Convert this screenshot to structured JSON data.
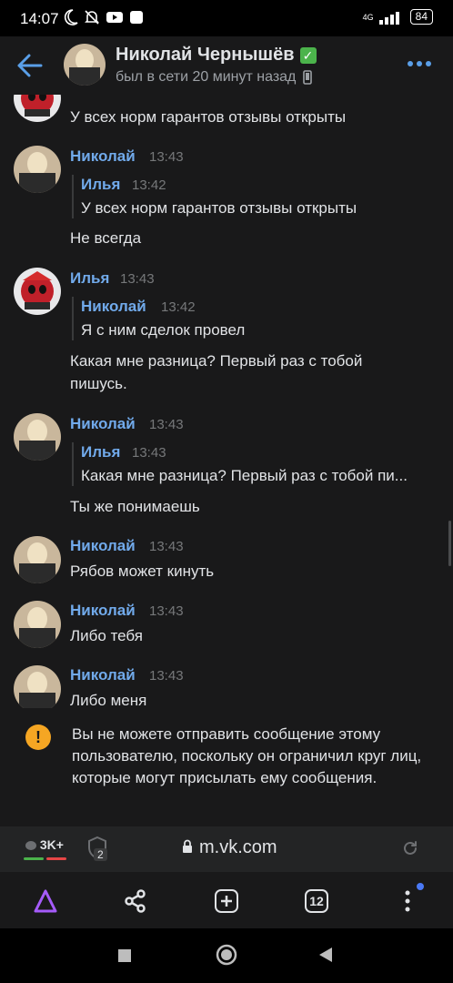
{
  "status_bar": {
    "time": "14:07",
    "network": "4G",
    "battery": "84"
  },
  "header": {
    "name": "Николай Чернышёв",
    "verified_mark": "✓",
    "status": "был в сети 20 минут назад",
    "back_icon": "arrow-left-icon",
    "more_icon": "more-dots-icon"
  },
  "messages": [
    {
      "text": "У всех норм гарантов отзывы открыты"
    },
    {
      "author": "Николай",
      "time": "13:43",
      "quote": {
        "author": "Илья",
        "time": "13:42",
        "text": "У всех норм гарантов отзывы открыты"
      },
      "text": "Не всегда"
    },
    {
      "author": "Илья",
      "time": "13:43",
      "quote": {
        "author": "Николай",
        "time": "13:42",
        "text": "Я с ним сделок провел"
      },
      "text_line1": "Какая мне разница? Первый раз с тобой",
      "text_line2": "пишусь."
    },
    {
      "author": "Николай",
      "time": "13:43",
      "quote": {
        "author": "Илья",
        "time": "13:43",
        "text": "Какая мне разница? Первый раз с тобой пи..."
      },
      "text": "Ты же понимаешь"
    },
    {
      "author": "Николай",
      "time": "13:43",
      "text": "Рябов может кинуть"
    },
    {
      "author": "Николай",
      "time": "13:43",
      "text": "Либо тебя"
    },
    {
      "author": "Николай",
      "time": "13:43",
      "text": "Либо меня"
    }
  ],
  "notice": {
    "icon": "!",
    "text": "Вы не можете отправить сообщение этому пользователю, поскольку он ограничил круг лиц, которые могут присылать ему сообщения."
  },
  "browser": {
    "comments_badge": "3K+",
    "shield_count": "2",
    "url": "m.vk.com"
  },
  "bottom_nav": {
    "tabs_count": "12"
  },
  "colors": {
    "accent": "#71aaeb",
    "background": "#19191a",
    "warning": "#f5a623",
    "verified": "#4bb34b"
  }
}
